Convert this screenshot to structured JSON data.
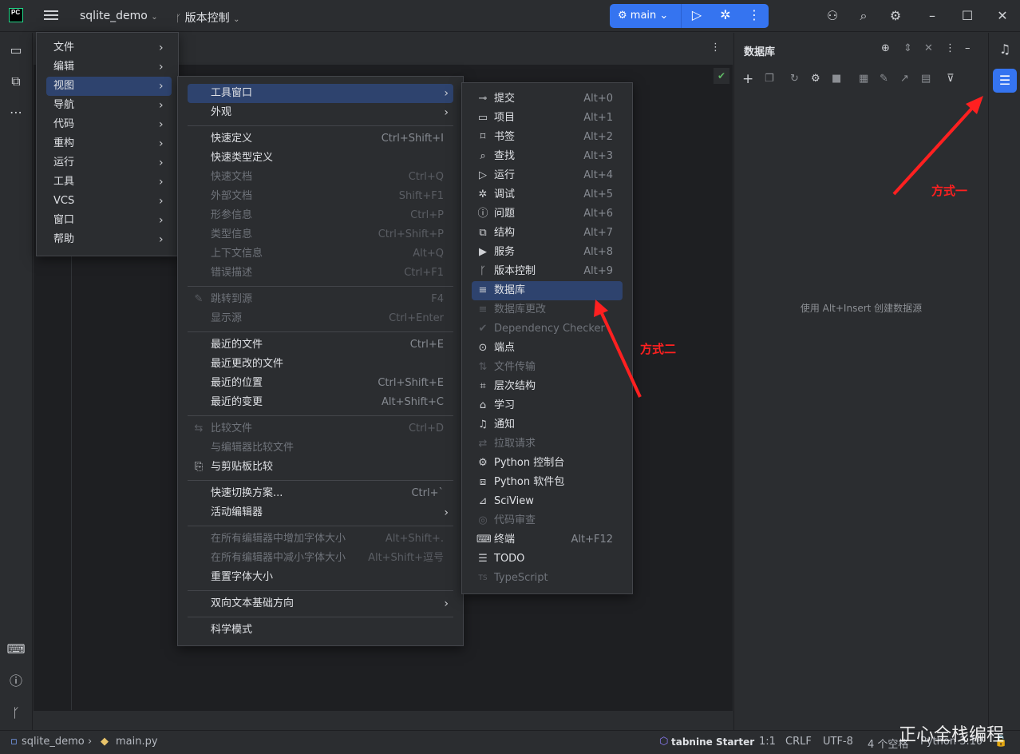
{
  "topbar": {
    "logo": "PC",
    "project": "sqlite_demo",
    "vcs": "版本控制",
    "run_config": "main"
  },
  "menu1": [
    {
      "label": "文件"
    },
    {
      "label": "编辑"
    },
    {
      "label": "视图"
    },
    {
      "label": "导航"
    },
    {
      "label": "代码"
    },
    {
      "label": "重构"
    },
    {
      "label": "运行"
    },
    {
      "label": "工具"
    },
    {
      "label": "VCS"
    },
    {
      "label": "窗口"
    },
    {
      "label": "帮助"
    }
  ],
  "menu2": [
    {
      "label": "工具窗口",
      "sc": ""
    },
    {
      "label": "外观",
      "sc": ""
    },
    {
      "label": "快速定义",
      "sc": "Ctrl+Shift+I"
    },
    {
      "label": "快速类型定义",
      "sc": ""
    },
    {
      "label": "快速文档",
      "sc": "Ctrl+Q"
    },
    {
      "label": "外部文档",
      "sc": "Shift+F1"
    },
    {
      "label": "形参信息",
      "sc": "Ctrl+P"
    },
    {
      "label": "类型信息",
      "sc": "Ctrl+Shift+P"
    },
    {
      "label": "上下文信息",
      "sc": "Alt+Q"
    },
    {
      "label": "错误描述",
      "sc": "Ctrl+F1"
    },
    {
      "label": "跳转到源",
      "sc": "F4"
    },
    {
      "label": "显示源",
      "sc": "Ctrl+Enter"
    },
    {
      "label": "最近的文件",
      "sc": "Ctrl+E"
    },
    {
      "label": "最近更改的文件",
      "sc": ""
    },
    {
      "label": "最近的位置",
      "sc": "Ctrl+Shift+E"
    },
    {
      "label": "最近的变更",
      "sc": "Alt+Shift+C"
    },
    {
      "label": "比较文件",
      "sc": "Ctrl+D"
    },
    {
      "label": "与编辑器比较文件",
      "sc": ""
    },
    {
      "label": "与剪贴板比较",
      "sc": ""
    },
    {
      "label": "快速切换方案...",
      "sc": "Ctrl+`"
    },
    {
      "label": "活动编辑器",
      "sc": ""
    },
    {
      "label": "在所有编辑器中增加字体大小",
      "sc": "Alt+Shift+."
    },
    {
      "label": "在所有编辑器中减小字体大小",
      "sc": "Alt+Shift+逗号"
    },
    {
      "label": "重置字体大小",
      "sc": ""
    },
    {
      "label": "双向文本基础方向",
      "sc": ""
    },
    {
      "label": "科学模式",
      "sc": ""
    }
  ],
  "menu3": [
    {
      "label": "提交",
      "sc": "Alt+0"
    },
    {
      "label": "项目",
      "sc": "Alt+1"
    },
    {
      "label": "书签",
      "sc": "Alt+2"
    },
    {
      "label": "查找",
      "sc": "Alt+3"
    },
    {
      "label": "运行",
      "sc": "Alt+4"
    },
    {
      "label": "调试",
      "sc": "Alt+5"
    },
    {
      "label": "问题",
      "sc": "Alt+6"
    },
    {
      "label": "结构",
      "sc": "Alt+7"
    },
    {
      "label": "服务",
      "sc": "Alt+8"
    },
    {
      "label": "版本控制",
      "sc": "Alt+9"
    },
    {
      "label": "数据库",
      "sc": ""
    },
    {
      "label": "数据库更改",
      "sc": ""
    },
    {
      "label": "Dependency Checker",
      "sc": ""
    },
    {
      "label": "端点",
      "sc": ""
    },
    {
      "label": "文件传输",
      "sc": ""
    },
    {
      "label": "层次结构",
      "sc": ""
    },
    {
      "label": "学习",
      "sc": ""
    },
    {
      "label": "通知",
      "sc": ""
    },
    {
      "label": "拉取请求",
      "sc": ""
    },
    {
      "label": "Python 控制台",
      "sc": ""
    },
    {
      "label": "Python 软件包",
      "sc": ""
    },
    {
      "label": "SciView",
      "sc": ""
    },
    {
      "label": "代码审查",
      "sc": ""
    },
    {
      "label": "终端",
      "sc": "Alt+F12"
    },
    {
      "label": "TODO",
      "sc": ""
    },
    {
      "label": "TypeScript",
      "sc": ""
    }
  ],
  "dbpanel": {
    "title": "数据库",
    "empty": "使用 Alt+Insert 创建数据源"
  },
  "annotations": {
    "one": "方式一",
    "two": "方式二"
  },
  "status": {
    "project": "sqlite_demo",
    "file": "main.py",
    "tabnine": "tabnine Starter",
    "pos": "1:1",
    "eol": "CRLF",
    "enc": "UTF-8",
    "indent": "4 个空格",
    "interp": "Python 3.10"
  },
  "watermark": "正心全栈编程",
  "colors": {
    "accent": "#3574f0",
    "selection": "#2e436e",
    "annotation": "#ff2020"
  }
}
